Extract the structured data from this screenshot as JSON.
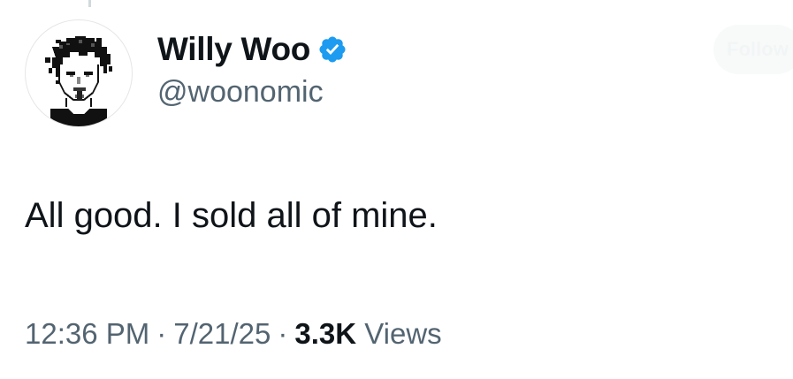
{
  "author": {
    "display_name": "Willy Woo",
    "handle": "@woonomic",
    "verified": true,
    "avatar_icon": "pixel-portrait-avatar",
    "verified_icon": "verified-badge-icon",
    "verified_color": "#1d9bf0"
  },
  "follow": {
    "label": "Follow"
  },
  "tweet": {
    "text": "All good. I sold all of mine."
  },
  "meta": {
    "time": "12:36 PM",
    "separator": "·",
    "date": "7/21/25",
    "views_count": "3.3K",
    "views_label": "Views"
  },
  "colors": {
    "text_primary": "#0f1419",
    "text_secondary": "#536471",
    "background": "#ffffff"
  }
}
